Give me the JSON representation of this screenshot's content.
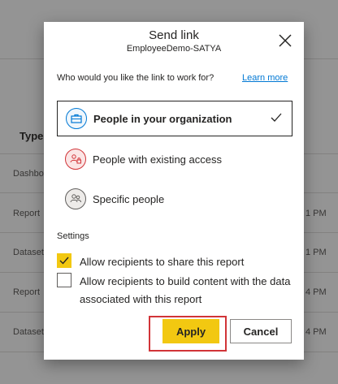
{
  "background": {
    "column_header": "Type",
    "rows": [
      {
        "type": "Dashbo",
        "time": ""
      },
      {
        "type": "Report",
        "time": "1 PM"
      },
      {
        "type": "Dataset",
        "time": "1 PM"
      },
      {
        "type": "Report",
        "time": "4 PM"
      },
      {
        "type": "Dataset",
        "time": "4 PM"
      }
    ]
  },
  "dialog": {
    "title": "Send link",
    "subtitle": "EmployeeDemo-SATYA",
    "question": "Who would you like the link to work for?",
    "learn_more": "Learn more",
    "options": [
      {
        "label": "People in your organization",
        "icon": "briefcase-icon",
        "selected": true,
        "icon_bg": "#eff6fc",
        "icon_border": "#0078d4"
      },
      {
        "label": "People with existing access",
        "icon": "people-lock-icon",
        "selected": false,
        "icon_bg": "#fbe5e5",
        "icon_border": "#d13438"
      },
      {
        "label": "Specific people",
        "icon": "people-icon",
        "selected": false,
        "icon_bg": "#edebe9",
        "icon_border": "#605e5c"
      }
    ],
    "settings_label": "Settings",
    "checkboxes": [
      {
        "label": "Allow recipients to share this report",
        "checked": true
      },
      {
        "label": "Allow recipients to build content with the data associated with this report",
        "checked": false
      }
    ],
    "apply_label": "Apply",
    "cancel_label": "Cancel"
  },
  "colors": {
    "accent_yellow": "#f2c811",
    "link_blue": "#0078d4",
    "highlight_red": "#d13438"
  }
}
